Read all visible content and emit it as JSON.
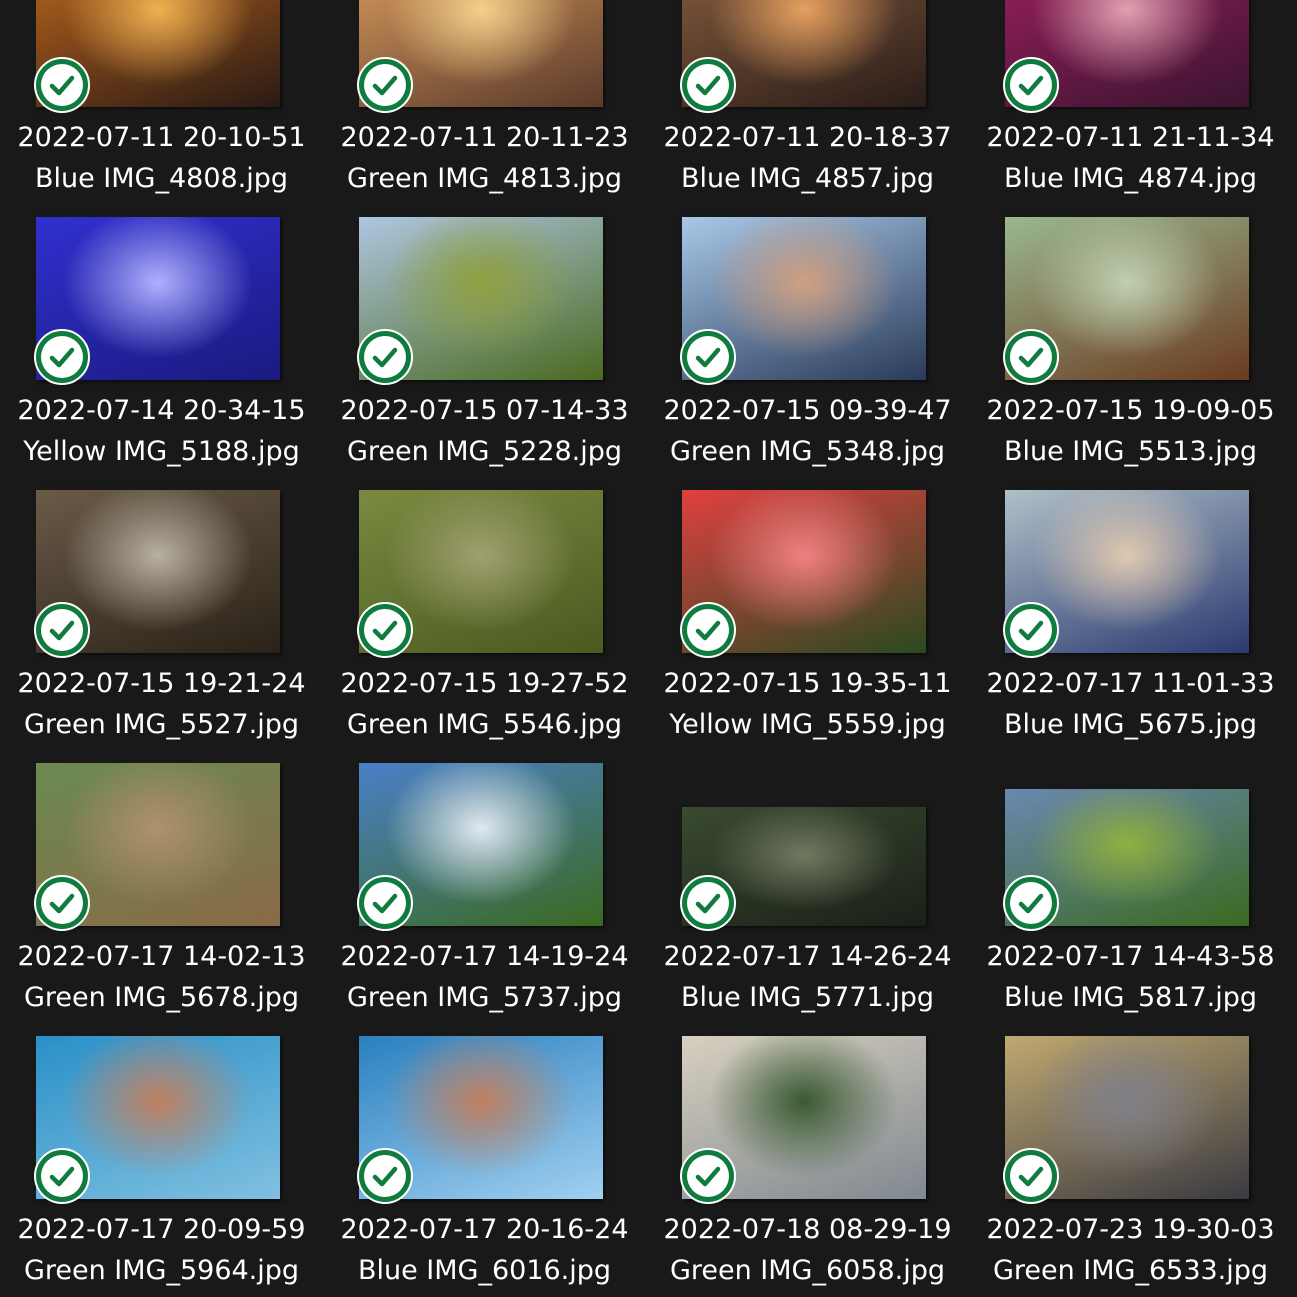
{
  "items": [
    {
      "date": "2022-07-11 20-10-51",
      "file": "Blue IMG_4808.jpg",
      "aspect": "landscape",
      "colors": [
        "#c46a1e",
        "#2a1a14",
        "#f0b050"
      ]
    },
    {
      "date": "2022-07-11 20-11-23",
      "file": "Green IMG_4813.jpg",
      "aspect": "landscape",
      "colors": [
        "#e0a060",
        "#5a3a2a",
        "#f3d08a"
      ]
    },
    {
      "date": "2022-07-11 20-18-37",
      "file": "Blue IMG_4857.jpg",
      "aspect": "landscape",
      "colors": [
        "#8a6040",
        "#2a1c18",
        "#e6a060"
      ]
    },
    {
      "date": "2022-07-11 21-11-34",
      "file": "Blue IMG_4874.jpg",
      "aspect": "landscape",
      "colors": [
        "#a02060",
        "#3a1430",
        "#e0a0b0"
      ]
    },
    {
      "date": "2022-07-14 20-34-15",
      "file": "Yellow IMG_5188.jpg",
      "aspect": "landscape",
      "colors": [
        "#3030d0",
        "#1a1a80",
        "#b0b0ff"
      ]
    },
    {
      "date": "2022-07-15 07-14-33",
      "file": "Green IMG_5228.jpg",
      "aspect": "landscape",
      "colors": [
        "#aec6e0",
        "#4a6a20",
        "#90a040"
      ]
    },
    {
      "date": "2022-07-15 09-39-47",
      "file": "Green IMG_5348.jpg",
      "aspect": "landscape",
      "colors": [
        "#a8c8e8",
        "#2a3a5a",
        "#d0a080"
      ]
    },
    {
      "date": "2022-07-15 19-09-05",
      "file": "Blue IMG_5513.jpg",
      "aspect": "landscape",
      "colors": [
        "#9ab890",
        "#6a3a20",
        "#c0d0b0"
      ]
    },
    {
      "date": "2022-07-15 19-21-24",
      "file": "Green IMG_5527.jpg",
      "aspect": "landscape",
      "colors": [
        "#6a5a48",
        "#2a2218",
        "#b8b0a0"
      ]
    },
    {
      "date": "2022-07-15 19-27-52",
      "file": "Green IMG_5546.jpg",
      "aspect": "landscape",
      "colors": [
        "#7a8a40",
        "#4a5a20",
        "#a0a070"
      ]
    },
    {
      "date": "2022-07-15 19-35-11",
      "file": "Yellow IMG_5559.jpg",
      "aspect": "landscape",
      "colors": [
        "#e04040",
        "#2a4a20",
        "#f08080"
      ]
    },
    {
      "date": "2022-07-17 11-01-33",
      "file": "Blue IMG_5675.jpg",
      "aspect": "landscape",
      "colors": [
        "#b0c0c8",
        "#2a3a70",
        "#e0c8b0"
      ]
    },
    {
      "date": "2022-07-17 14-02-13",
      "file": "Green IMG_5678.jpg",
      "aspect": "landscape",
      "colors": [
        "#6a8a50",
        "#8a6a4a",
        "#b09070"
      ]
    },
    {
      "date": "2022-07-17 14-19-24",
      "file": "Green IMG_5737.jpg",
      "aspect": "landscape",
      "colors": [
        "#4a80c8",
        "#3a6a20",
        "#e0e8f0"
      ]
    },
    {
      "date": "2022-07-17 14-26-24",
      "file": "Blue IMG_5771.jpg",
      "aspect": "wide",
      "colors": [
        "#3a4a30",
        "#1a2018",
        "#707860"
      ]
    },
    {
      "date": "2022-07-17 14-43-58",
      "file": "Blue IMG_5817.jpg",
      "aspect": "wide",
      "colors": [
        "#6a88b0",
        "#3a6a20",
        "#90b040"
      ]
    },
    {
      "date": "2022-07-17 20-09-59",
      "file": "Green IMG_5964.jpg",
      "aspect": "landscape",
      "colors": [
        "#2a90c8",
        "#80c0e0",
        "#c08060"
      ]
    },
    {
      "date": "2022-07-17 20-16-24",
      "file": "Blue IMG_6016.jpg",
      "aspect": "landscape",
      "colors": [
        "#2a80c0",
        "#a0d0f0",
        "#c08060"
      ]
    },
    {
      "date": "2022-07-18 08-29-19",
      "file": "Green IMG_6058.jpg",
      "aspect": "landscape",
      "colors": [
        "#d8d0c0",
        "#808890",
        "#3a5a30"
      ]
    },
    {
      "date": "2022-07-23 19-30-03",
      "file": "Green IMG_6533.jpg",
      "aspect": "landscape",
      "colors": [
        "#c0a870",
        "#3a3a40",
        "#80808a"
      ]
    }
  ],
  "check_icon": "checkmark-icon",
  "accent": "#0f7b3f"
}
